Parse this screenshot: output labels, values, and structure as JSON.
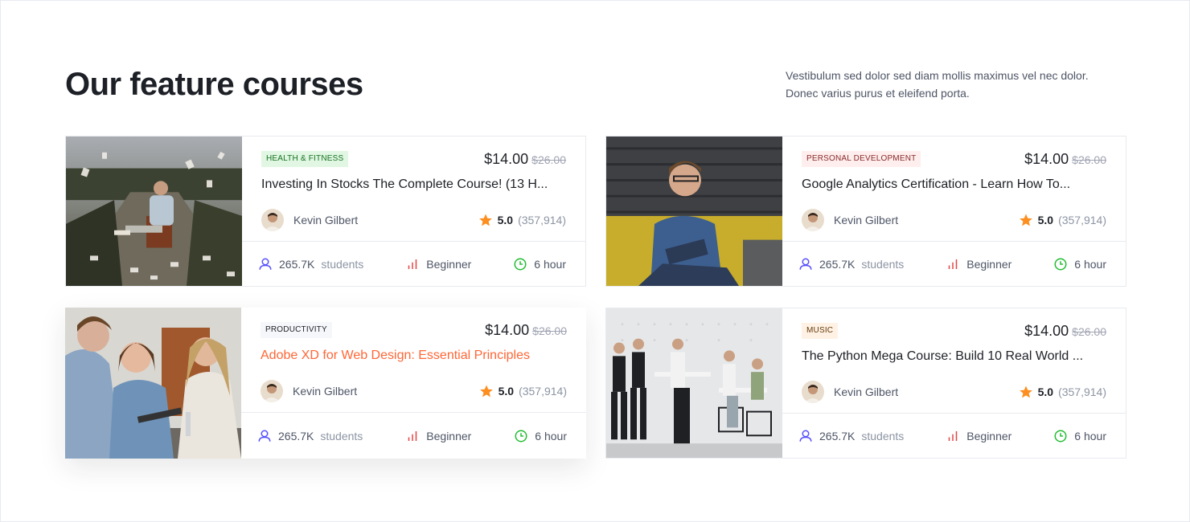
{
  "section": {
    "heading": "Our feature courses",
    "description": "Vestibulum sed dolor sed diam mollis maximus vel nec dolor. Donec varius purus et eleifend porta."
  },
  "colors": {
    "accent": "#ff6636",
    "star": "#fd8e1f",
    "students_icon": "#564ffd",
    "level_icon": "#e34444",
    "time_icon": "#23bd33"
  },
  "courses": [
    {
      "category": "HEALTH & FITNESS",
      "category_bg": "#e1f7e3",
      "category_color": "#15711f",
      "price": "$14.00",
      "old_price": "$26.00",
      "title": "Investing In Stocks The Complete Course! (13 H...",
      "instructor": "Kevin Gilbert",
      "rating": "5.0",
      "rating_count": "(357,914)",
      "students": "265.7K",
      "students_label": "students",
      "level": "Beginner",
      "duration": "6 hour"
    },
    {
      "category": "PERSONAL DEVELOPMENT",
      "category_bg": "#ffeeee",
      "category_color": "#882929",
      "price": "$14.00",
      "old_price": "$26.00",
      "title": "Google Analytics Certification - Learn How To...",
      "instructor": "Kevin Gilbert",
      "rating": "5.0",
      "rating_count": "(357,914)",
      "students": "265.7K",
      "students_label": "students",
      "level": "Beginner",
      "duration": "6 hour"
    },
    {
      "category": "PRODUCTIVITY",
      "category_bg": "#f5f7fa",
      "category_color": "#1d2026",
      "price": "$14.00",
      "old_price": "$26.00",
      "title": "Adobe XD for Web Design: Essential Principles",
      "instructor": "Kevin Gilbert",
      "rating": "5.0",
      "rating_count": "(357,914)",
      "students": "265.7K",
      "students_label": "students",
      "level": "Beginner",
      "duration": "6 hour"
    },
    {
      "category": "MUSIC",
      "category_bg": "#fff2e5",
      "category_color": "#65390c",
      "price": "$14.00",
      "old_price": "$26.00",
      "title": "The Python Mega Course: Build 10 Real World ...",
      "instructor": "Kevin Gilbert",
      "rating": "5.0",
      "rating_count": "(357,914)",
      "students": "265.7K",
      "students_label": "students",
      "level": "Beginner",
      "duration": "6 hour"
    }
  ]
}
